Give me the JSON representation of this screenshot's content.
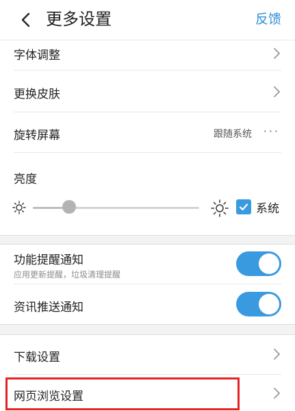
{
  "header": {
    "title": "更多设置",
    "feedback_label": "反馈",
    "back_icon": "chevron-left-icon"
  },
  "settings": {
    "font_adjust": "字体调整",
    "change_skin": "更换皮肤",
    "rotate_screen": {
      "label": "旋转屏幕",
      "value": "跟随系统",
      "more": "···"
    },
    "brightness": {
      "label": "亮度",
      "level": 0.22,
      "system_label": "系统",
      "system_checked": true
    },
    "feature_notify": {
      "label": "功能提醒通知",
      "description": "应用更新提醒，垃圾清理提醒",
      "enabled": true
    },
    "news_push": {
      "label": "资讯推送通知",
      "enabled": true
    },
    "download": "下载设置",
    "web_browse": "网页浏览设置"
  },
  "colors": {
    "accent": "#3a9ae0",
    "link": "#2f8fd7",
    "highlight": "#e52222"
  }
}
